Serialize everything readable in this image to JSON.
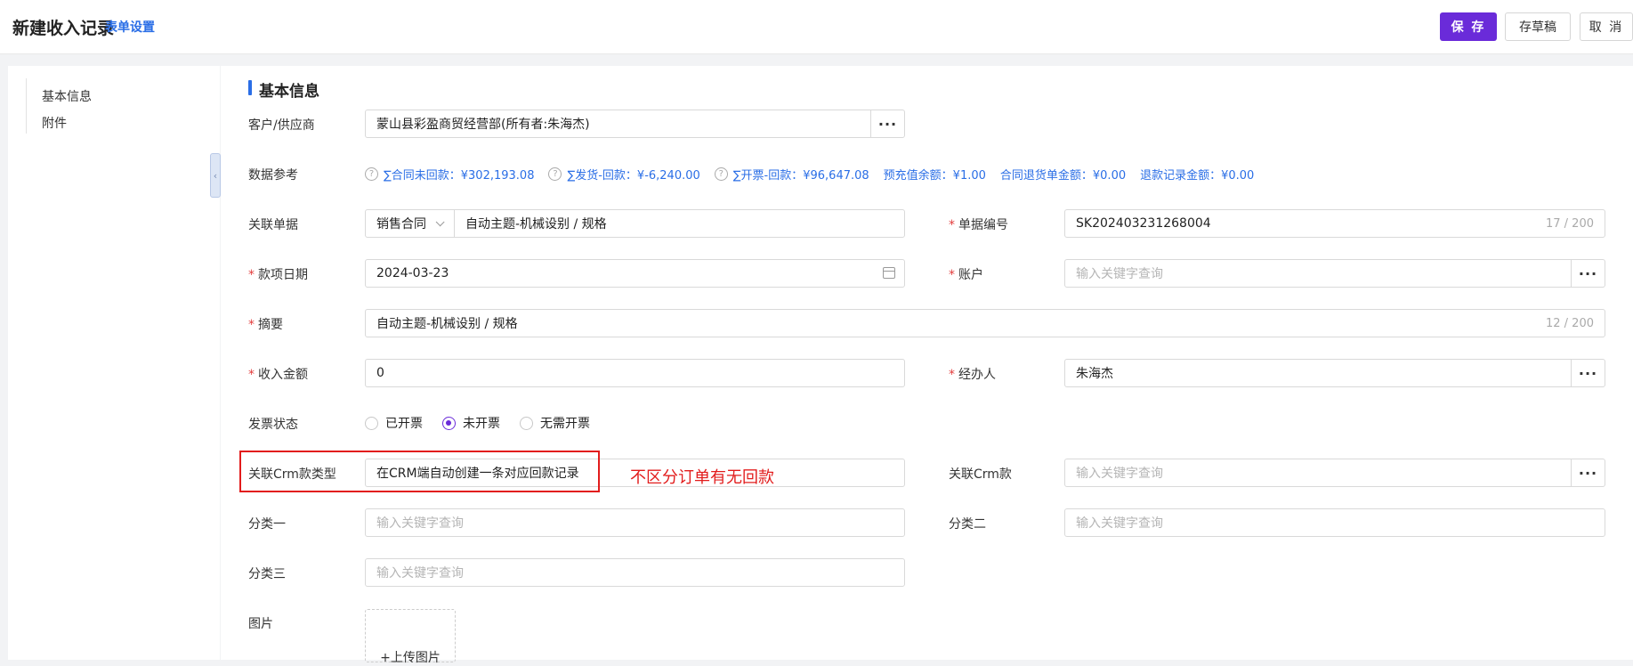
{
  "header": {
    "title": "新建收入记录",
    "form_settings": "表单设置",
    "save": "保 存",
    "draft": "存草稿",
    "cancel": "取 消"
  },
  "sidebar": {
    "items": [
      {
        "label": "基本信息"
      },
      {
        "label": "附件"
      }
    ]
  },
  "section": {
    "title": "基本信息"
  },
  "form": {
    "customer": {
      "label": "客户/供应商",
      "value": "蒙山县彩盈商贸经营部(所有者:朱海杰)"
    },
    "ref": {
      "label": "数据参考",
      "items": [
        {
          "text": "∑合同未回款：¥302,193.08",
          "help": true
        },
        {
          "text": "∑发货-回款：¥-6,240.00",
          "help": true
        },
        {
          "text": "∑开票-回款：¥96,647.08",
          "help": true
        },
        {
          "text": "预充值余额：¥1.00",
          "help": false
        },
        {
          "text": "合同退货单金额：¥0.00",
          "help": false
        },
        {
          "text": "退款记录金额：¥0.00",
          "help": false
        }
      ]
    },
    "related_doc": {
      "label": "关联单据",
      "type": "销售合同",
      "value": "自动主题-机械设别 / 规格"
    },
    "doc_no": {
      "label": "单据编号",
      "value": "SK202403231268004",
      "counter": "17 / 200"
    },
    "date": {
      "label": "款项日期",
      "value": "2024-03-23"
    },
    "account": {
      "label": "账户",
      "placeholder": "输入关键字查询"
    },
    "summary": {
      "label": "摘要",
      "value": "自动主题-机械设别 / 规格",
      "counter": "12 / 200"
    },
    "amount": {
      "label": "收入金额",
      "value": "0"
    },
    "handler": {
      "label": "经办人",
      "value": "朱海杰"
    },
    "invoice": {
      "label": "发票状态",
      "options": [
        "已开票",
        "未开票",
        "无需开票"
      ],
      "selected": "未开票"
    },
    "crm_type": {
      "label": "关联Crm款类型",
      "value": "在CRM端自动创建一条对应回款记录"
    },
    "crm_payment": {
      "label": "关联Crm款",
      "placeholder": "输入关键字查询"
    },
    "cat1": {
      "label": "分类一",
      "placeholder": "输入关键字查询"
    },
    "cat2": {
      "label": "分类二",
      "placeholder": "输入关键字查询"
    },
    "cat3": {
      "label": "分类三",
      "placeholder": "输入关键字查询"
    },
    "image": {
      "label": "图片",
      "upload": "+上传图片"
    }
  },
  "annotation": {
    "text": "不区分订单有无回款",
    "color": "#e21c1c"
  },
  "colors": {
    "primary": "#6a2bd9",
    "link": "#2a6ee6",
    "required": "#e23c3c"
  }
}
